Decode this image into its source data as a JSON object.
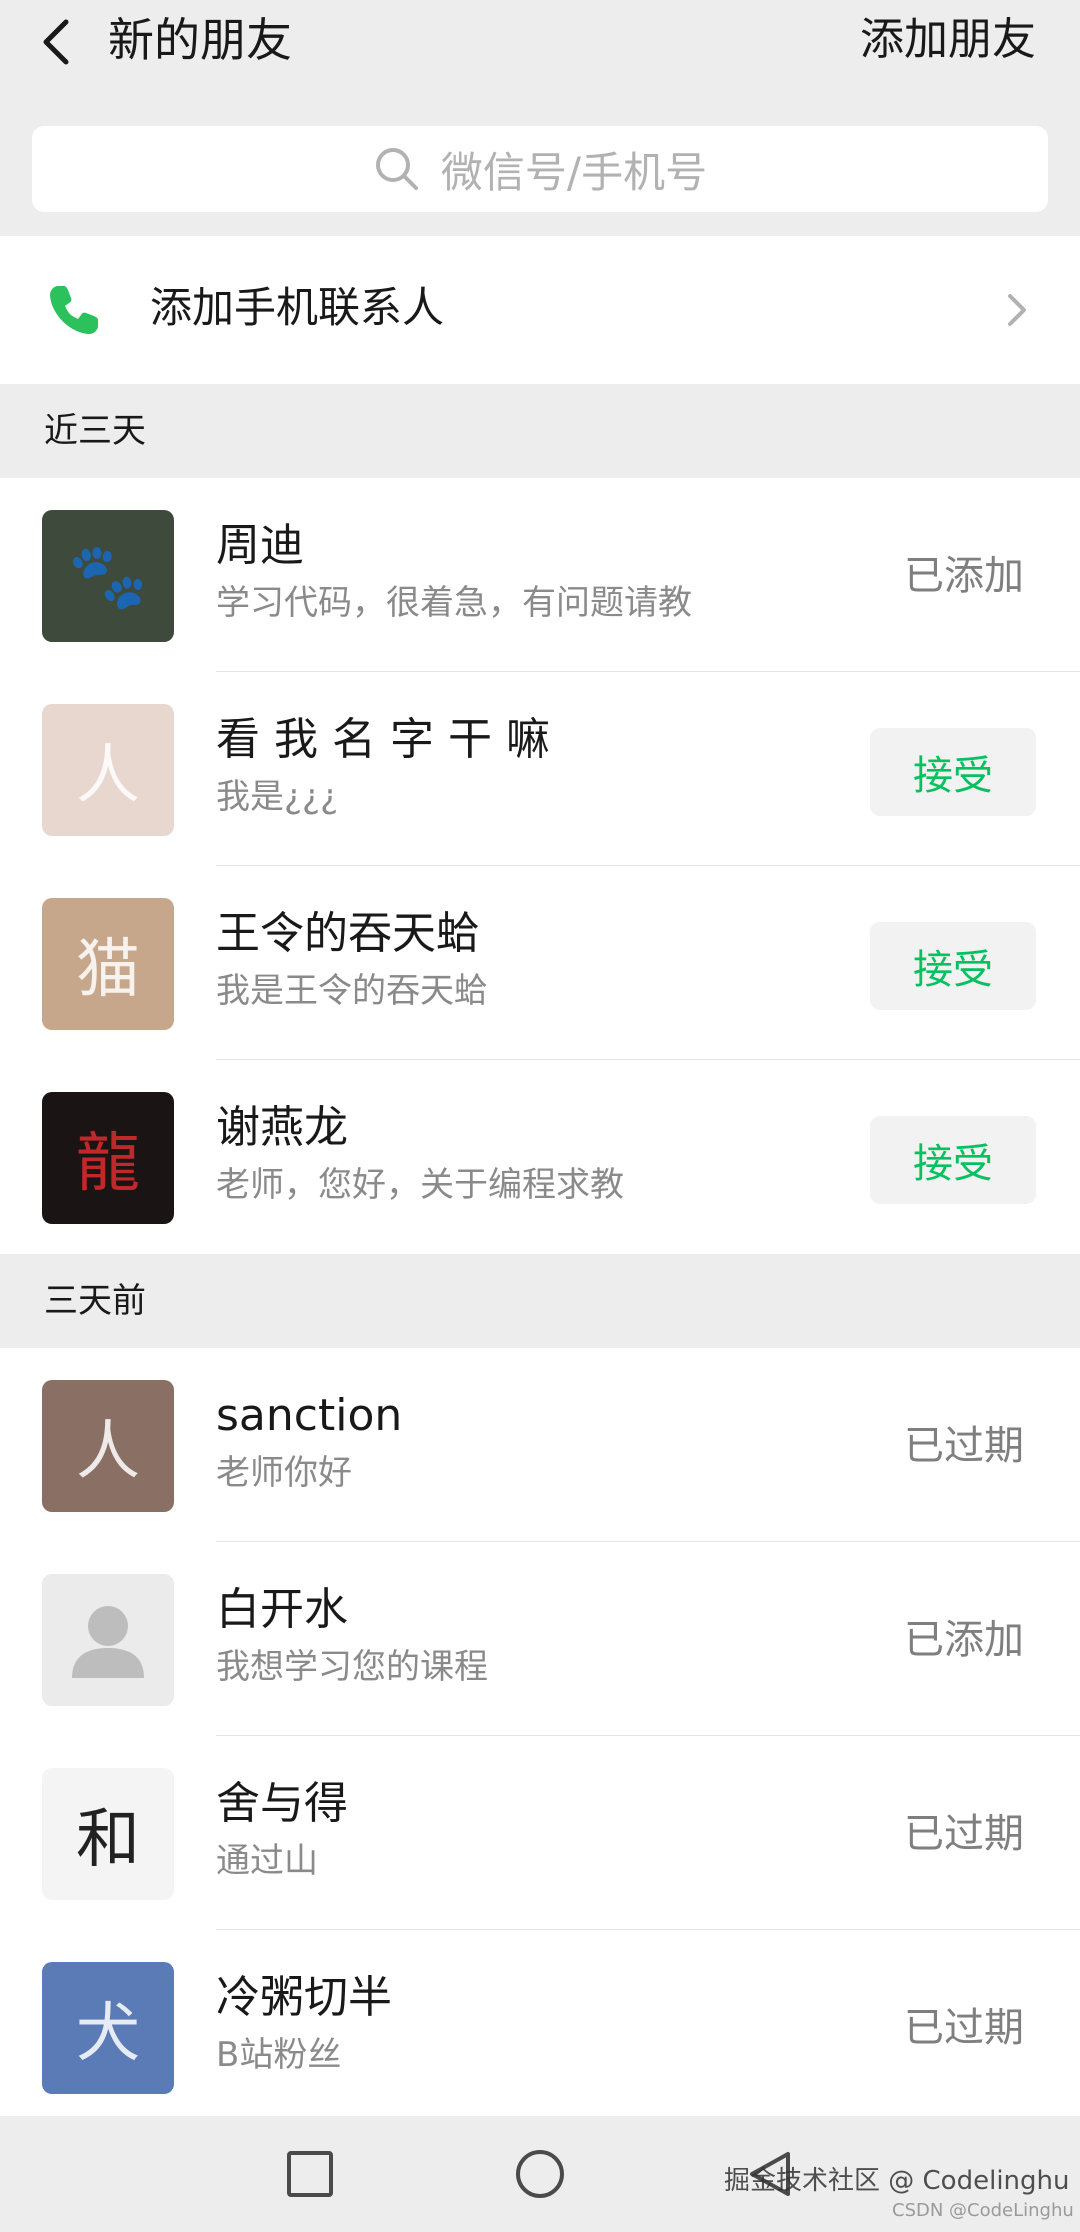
{
  "header": {
    "title": "新的朋友",
    "add_friend": "添加朋友"
  },
  "search": {
    "placeholder": "微信号/手机号"
  },
  "phone_contacts": {
    "label": "添加手机联系人"
  },
  "colors": {
    "accent_green": "#07c160",
    "phone_icon": "#2bc15c",
    "background": "#ededed"
  },
  "friend_sections": [
    {
      "title": "近三天",
      "items": [
        {
          "name": "周迪",
          "message": "学习代码，很着急，有问题请教",
          "status": "已添加",
          "action": "status",
          "avatar_bg": "#3d4a3c",
          "avatar_glyph": "🐾"
        },
        {
          "name": "看 我 名 字 干 嘛",
          "message": "我是¿¿¿",
          "status": "接受",
          "action": "accept",
          "avatar_bg": "#e8d7cf",
          "avatar_glyph": "人"
        },
        {
          "name": "王令的吞天蛤",
          "message": "我是王令的吞天蛤",
          "status": "接受",
          "action": "accept",
          "avatar_bg": "#c7a78b",
          "avatar_glyph": "猫"
        },
        {
          "name": "谢燕龙",
          "message": "老师，您好，关于编程求教",
          "status": "接受",
          "action": "accept",
          "avatar_bg": "#1a1414",
          "avatar_glyph": "龍"
        }
      ]
    },
    {
      "title": "三天前",
      "items": [
        {
          "name": "sanction",
          "message": "老师你好",
          "status": "已过期",
          "action": "status",
          "avatar_bg": "#8a7064",
          "avatar_glyph": "人"
        },
        {
          "name": "白开水",
          "message": "我想学习您的课程",
          "status": "已添加",
          "action": "status",
          "avatar_bg": "#ebebeb",
          "avatar_glyph": "default"
        },
        {
          "name": "舍与得",
          "message": "通过山",
          "status": "已过期",
          "action": "status",
          "avatar_bg": "#f4f4f4",
          "avatar_glyph": "和"
        },
        {
          "name": "冷粥切半",
          "message": "B站粉丝",
          "status": "已过期",
          "action": "status",
          "avatar_bg": "#5a7bb5",
          "avatar_glyph": "犬"
        }
      ]
    }
  ],
  "watermark": {
    "line1": "掘金技术社区 @ Codelinghu",
    "line2": "CSDN @CodeLinghu"
  }
}
